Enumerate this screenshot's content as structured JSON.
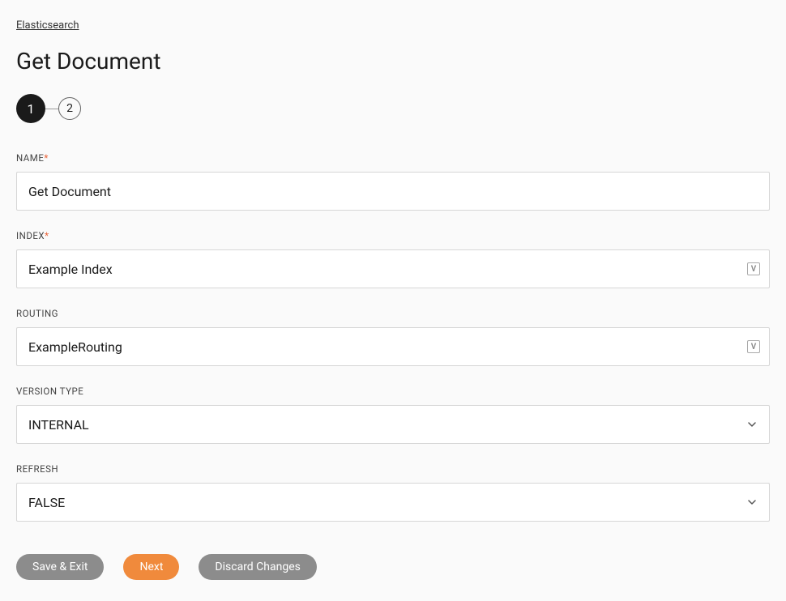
{
  "breadcrumb": "Elasticsearch",
  "title": "Get Document",
  "stepper": {
    "step1": "1",
    "step2": "2"
  },
  "fields": {
    "name": {
      "label": "NAME",
      "required": "*",
      "value": "Get Document"
    },
    "index": {
      "label": "INDEX",
      "required": "*",
      "value": "Example Index"
    },
    "routing": {
      "label": "ROUTING",
      "value": "ExampleRouting"
    },
    "version": {
      "label": "VERSION TYPE",
      "value": "INTERNAL"
    },
    "refresh": {
      "label": "REFRESH",
      "value": "FALSE"
    }
  },
  "iconGlyph": "V",
  "buttons": {
    "save": "Save & Exit",
    "next": "Next",
    "discard": "Discard Changes"
  }
}
